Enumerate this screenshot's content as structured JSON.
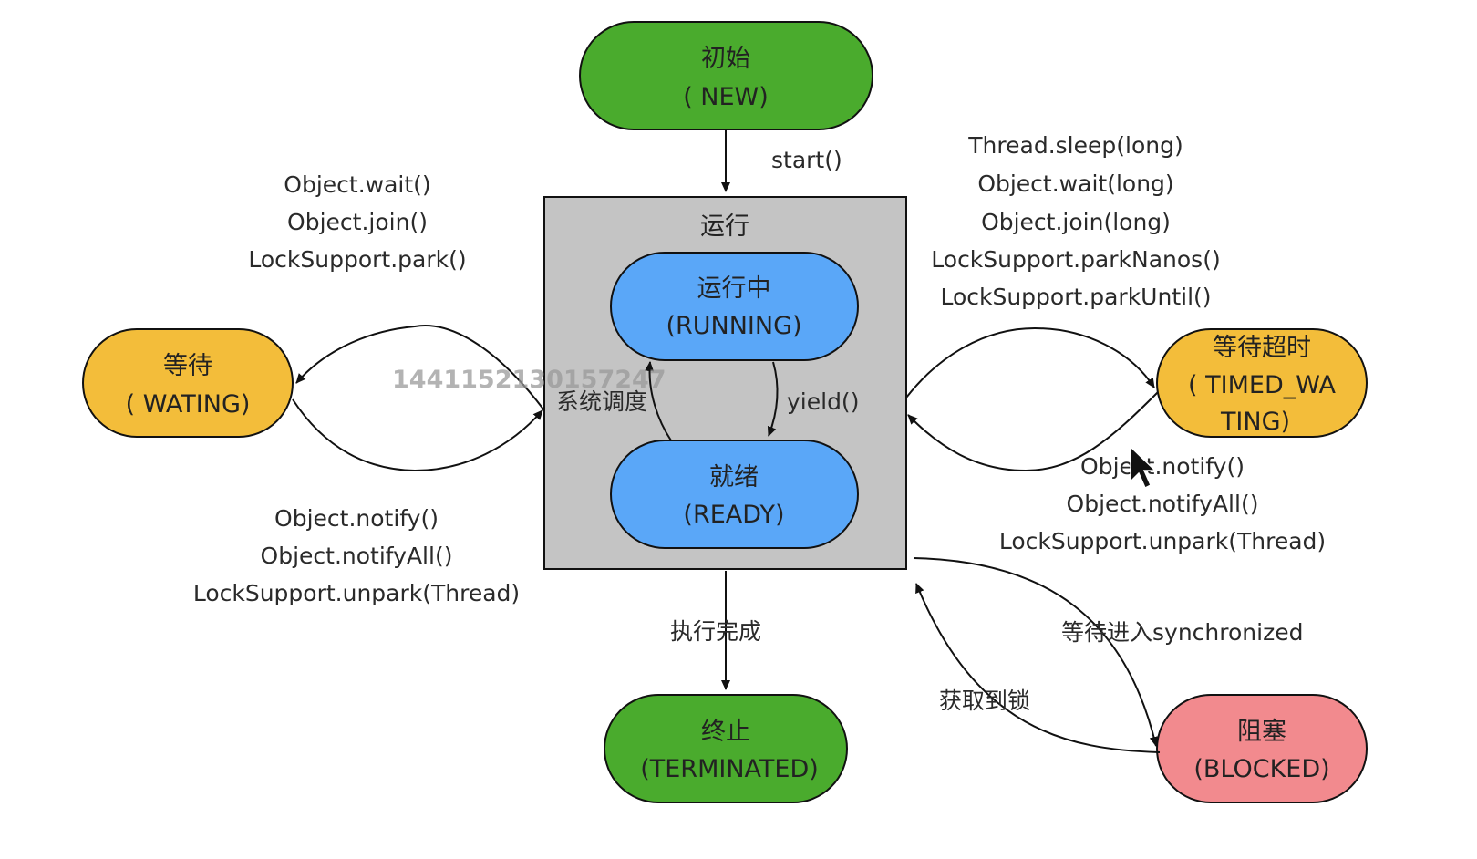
{
  "colors": {
    "start_end_fill": "#4aab2d",
    "running_fill": "#5aa7f8",
    "waiting_fill": "#f3bd3a",
    "blocked_fill": "#f28a8e",
    "container_fill": "#c4c4c4",
    "stroke": "#111111"
  },
  "nodes": {
    "new": {
      "line1": "初始",
      "line2": "( NEW)"
    },
    "running_group": {
      "title": "运行"
    },
    "running": {
      "line1": "运行中",
      "line2": "(RUNNING)"
    },
    "ready": {
      "line1": "就绪",
      "line2": "(READY)"
    },
    "waiting": {
      "line1": "等待",
      "line2": "( WATING)"
    },
    "timed_waiting": {
      "line1": "等待超时",
      "line2": "( TIMED_WA",
      "line3": "TING)"
    },
    "terminated": {
      "line1": "终止",
      "line2": "(TERMINATED)"
    },
    "blocked": {
      "line1": "阻塞",
      "line2": "(BLOCKED)"
    }
  },
  "edges": {
    "start": "start()",
    "yield": "yield()",
    "schedule": "系统调度",
    "finish": "执行完成",
    "enter_sync": "等待进入synchronized",
    "acquire_lock": "获取到锁",
    "to_waiting": [
      "Object.wait()",
      "Object.join()",
      "LockSupport.park()"
    ],
    "from_waiting": [
      "Object.notify()",
      "Object.notifyAll()",
      "LockSupport.unpark(Thread)"
    ],
    "to_timed_waiting": [
      "Thread.sleep(long)",
      "Object.wait(long)",
      "Object.join(long)",
      "LockSupport.parkNanos()",
      "LockSupport.parkUntil()"
    ],
    "from_timed_waiting": [
      "Object.notify()",
      "Object.notifyAll()",
      "LockSupport.unpark(Thread)"
    ]
  },
  "watermark": "1441152130157247",
  "icons": {
    "cursor": "mouse-pointer-icon"
  }
}
